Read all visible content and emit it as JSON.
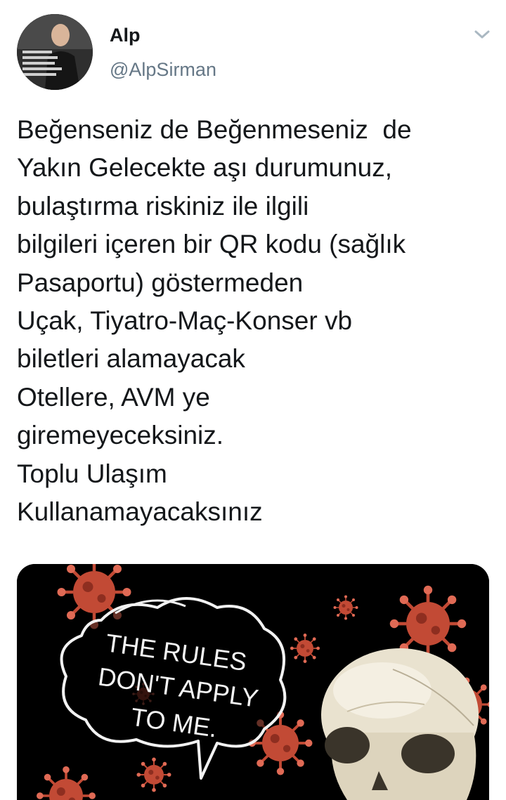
{
  "author": {
    "display_name": "Alp",
    "handle": "@AlpSirman",
    "avatar_icon": "profile-photo"
  },
  "menu": {
    "icon": "chevron-down-icon"
  },
  "tweet": {
    "lines": [
      "Beğenseniz de Beğenmeseniz  de",
      "Yakın Gelecekte aşı durumunuz,",
      "bulaştırma riskiniz ile ilgili",
      "bilgileri içeren bir QR kodu (sağlık",
      "Pasaportu) göstermeden",
      "Uçak, Tiyatro-Maç-Konser vb",
      "biletleri alamayacak",
      "Otellere, AVM ye",
      "giremeyeceksiniz.",
      "Toplu Ulaşım",
      "Kullanamayacaksınız"
    ]
  },
  "media": {
    "speech_bubble": [
      "THE RULES",
      "DON'T APPLY",
      "TO ME."
    ]
  },
  "colors": {
    "text": "#14171a",
    "secondary": "#657786",
    "virus": "#c24a35",
    "media_bg": "#000000"
  }
}
